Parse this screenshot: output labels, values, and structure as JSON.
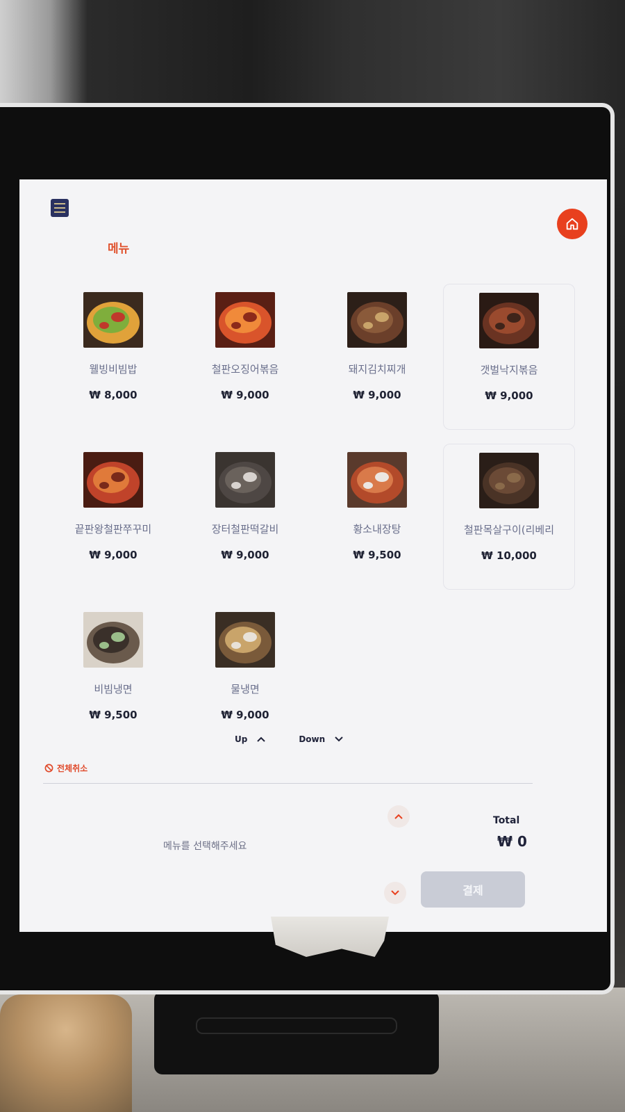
{
  "header": {
    "logo": "KPN-logo",
    "menu_title": "메뉴",
    "home_icon": "home-icon"
  },
  "menu_items": [
    {
      "name": "웰빙비빔밥",
      "price": "₩ 8,000",
      "food": "bibimbap"
    },
    {
      "name": "철판오징어볶음",
      "price": "₩ 9,000",
      "food": "squid"
    },
    {
      "name": "돼지김치찌개",
      "price": "₩ 9,000",
      "food": "meat"
    },
    {
      "name": "갯벌낙지볶음",
      "price": "₩ 9,000",
      "food": "octopus"
    },
    {
      "name": "끝판왕철판쭈꾸미",
      "price": "₩ 9,000",
      "food": "spicy"
    },
    {
      "name": "장터철판떡갈비",
      "price": "₩ 9,000",
      "food": "patty"
    },
    {
      "name": "황소내장탕",
      "price": "₩ 9,500",
      "food": "stew"
    },
    {
      "name": "철판목살구이(리베리",
      "price": "₩ 10,000",
      "food": "grill"
    },
    {
      "name": "비빔냉면",
      "price": "₩ 9,500",
      "food": "noodle"
    },
    {
      "name": "물냉면",
      "price": "₩ 9,000",
      "food": "coldnoodle"
    }
  ],
  "pager": {
    "up_label": "Up",
    "down_label": "Down"
  },
  "cart": {
    "cancel_all_label": "전체취소",
    "placeholder": "메뉴를 선택해주세요",
    "total_label": "Total",
    "total_value": "₩ 0",
    "pay_label": "결제"
  },
  "colors": {
    "accent": "#e8401e",
    "title": "#e0532f",
    "pay_disabled": "#c9ccd6",
    "logo_bg": "#2a3160"
  }
}
